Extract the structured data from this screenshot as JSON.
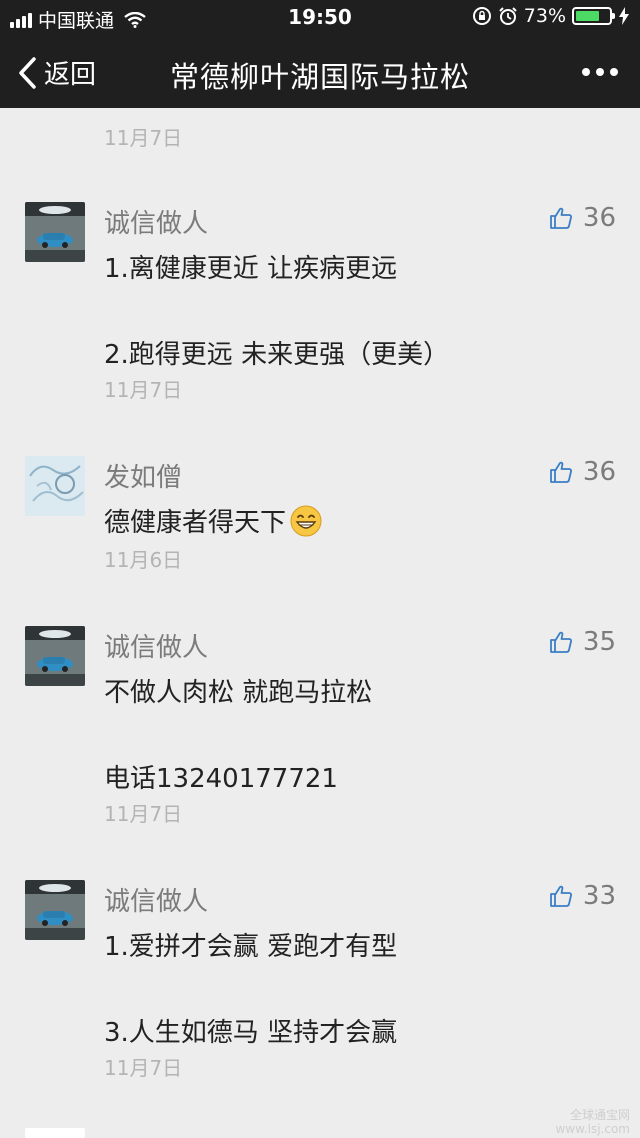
{
  "status_bar": {
    "carrier": "中国联通",
    "time": "19:50",
    "battery_percent": "73%",
    "battery_level": 0.73,
    "icons": [
      "signal-icon",
      "wifi-icon",
      "rotation-lock-icon",
      "alarm-icon",
      "battery-icon",
      "charging-icon"
    ]
  },
  "navbar": {
    "back_label": "返回",
    "title": "常德柳叶湖国际马拉松",
    "more_icon": "more-dots-icon"
  },
  "top_date": "11月7日",
  "comments": [
    {
      "nickname": "诚信做人",
      "likes": "36",
      "lines": [
        "1.离健康更近 让疾病更远",
        "2.跑得更远 未来更强（更美）"
      ],
      "date": "11月7日"
    },
    {
      "nickname": "发如僧",
      "likes": "36",
      "lines": [
        "德健康者得天下"
      ],
      "emoji": "grinning-face-emoji",
      "date": "11月6日"
    },
    {
      "nickname": "诚信做人",
      "likes": "35",
      "lines": [
        "不做人肉松 就跑马拉松",
        "电话13240177721"
      ],
      "date": "11月7日"
    },
    {
      "nickname": "诚信做人",
      "likes": "33",
      "lines": [
        "1.爱拼才会赢 爱跑才有型",
        "3.人生如德马 坚持才会赢"
      ],
      "date": "11月7日"
    }
  ],
  "watermark": {
    "line1": "全球通宝网",
    "line2": "www.lsj.com"
  },
  "colors": {
    "bar_bg": "#1f1f1f",
    "page_bg": "#ededed",
    "battery_green": "#4cd964",
    "meta_gray": "#7b7b7b"
  }
}
